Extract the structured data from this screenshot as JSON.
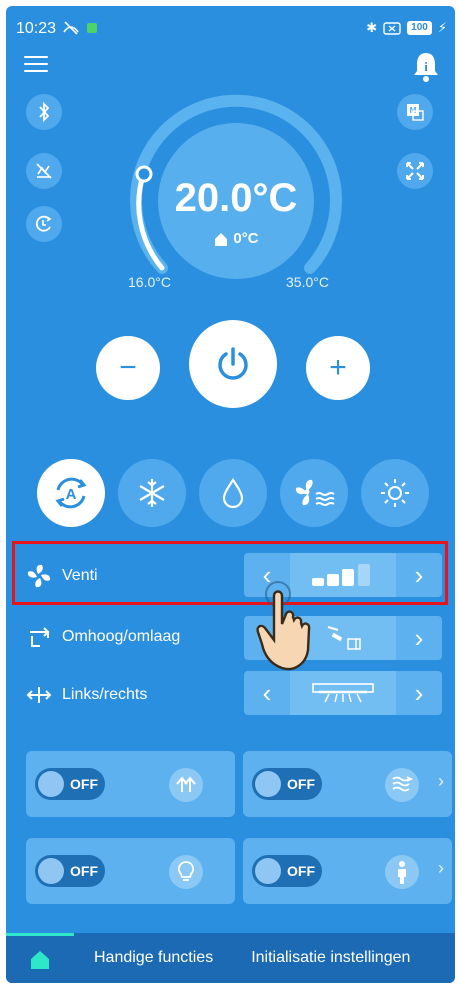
{
  "status_bar": {
    "time": "10:23",
    "battery": "100"
  },
  "header": {
    "menu_icon": "hamburger-menu-icon",
    "notification_icon": "bell-info-icon"
  },
  "thermostat": {
    "set_temperature": "20.0°C",
    "indoor_temperature": "0°C",
    "min_label": "16.0°C",
    "max_label": "35.0°C"
  },
  "side_buttons_left": [
    "bluetooth-icon",
    "sleep-off-icon",
    "timer-icon"
  ],
  "side_buttons_right": [
    "mode-m-icon",
    "expand-icon"
  ],
  "controls": {
    "minus_label": "−",
    "plus_label": "+",
    "power_icon": "power-icon"
  },
  "modes": [
    {
      "name": "auto",
      "icon": "auto-mode-icon",
      "active": true
    },
    {
      "name": "cool",
      "icon": "snowflake-icon",
      "active": false
    },
    {
      "name": "dry",
      "icon": "droplet-icon",
      "active": false
    },
    {
      "name": "fan",
      "icon": "fan-mode-icon",
      "active": false
    },
    {
      "name": "heat",
      "icon": "sun-icon",
      "active": false
    }
  ],
  "settings_rows": [
    {
      "label": "Venti",
      "icon": "fan-icon",
      "value_icon": "fan-speed-bars-icon",
      "level": 3,
      "max_level": 4
    },
    {
      "label": "Omhoog/omlaag",
      "icon": "vertical-swing-icon",
      "value_icon": "vertical-louver-icon"
    },
    {
      "label": "Links/rechts",
      "icon": "horizontal-swing-icon",
      "value_icon": "horizontal-louver-icon"
    }
  ],
  "feature_cards": [
    {
      "toggle": "OFF",
      "icon": "turbo-arrows-icon",
      "has_chevron": false
    },
    {
      "toggle": "OFF",
      "icon": "airflow-icon",
      "has_chevron": true
    },
    {
      "toggle": "OFF",
      "icon": "light-bulb-icon",
      "has_chevron": false
    },
    {
      "toggle": "OFF",
      "icon": "person-sensor-icon",
      "has_chevron": true
    }
  ],
  "tabs": [
    {
      "label": "",
      "icon": "home-icon",
      "active": true
    },
    {
      "label": "Handige functies",
      "active": false
    },
    {
      "label": "Initialisatie instellingen",
      "active": false
    }
  ],
  "colors": {
    "background": "#2a8fde",
    "highlight": "#e8141a",
    "tab_indicator": "#2ee6c8"
  }
}
